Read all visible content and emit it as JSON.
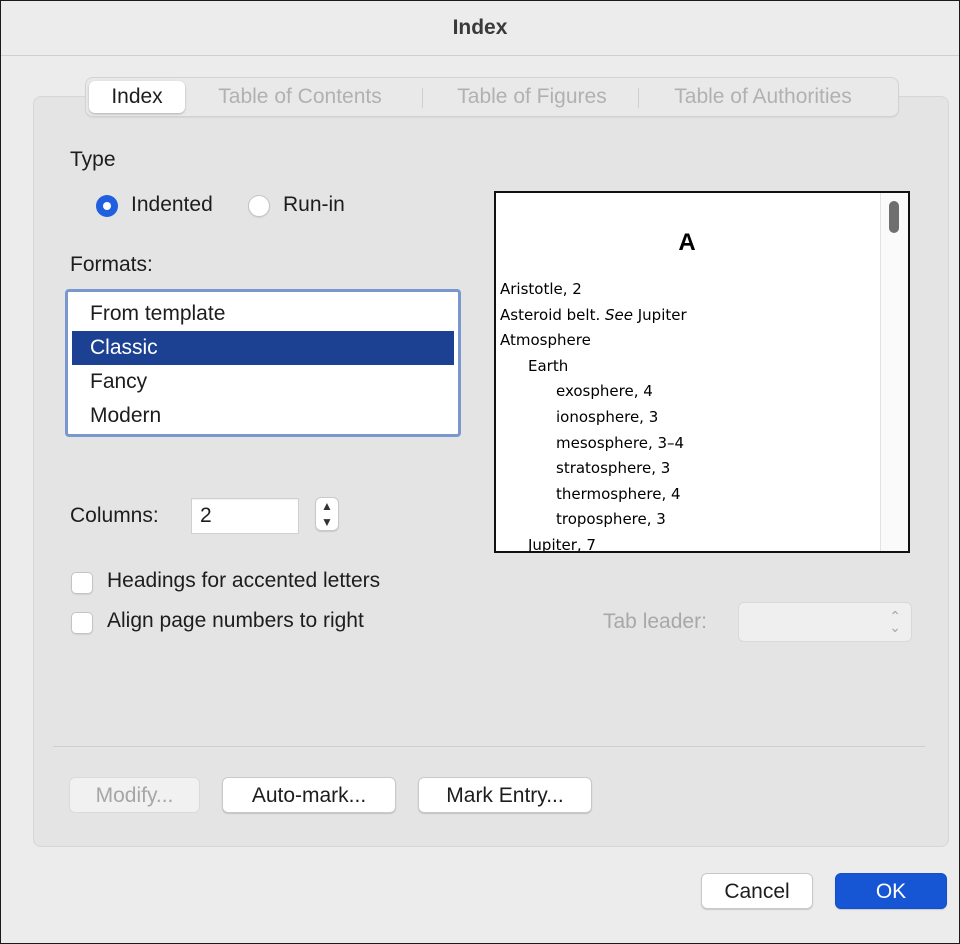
{
  "dialog": {
    "title": "Index"
  },
  "tabs": [
    {
      "label": "Index",
      "active": true
    },
    {
      "label": "Table of Contents",
      "active": false
    },
    {
      "label": "Table of Figures",
      "active": false
    },
    {
      "label": "Table of Authorities",
      "active": false
    }
  ],
  "type": {
    "label": "Type",
    "options": [
      {
        "label": "Indented",
        "selected": true
      },
      {
        "label": "Run-in",
        "selected": false
      }
    ]
  },
  "formats": {
    "label": "Formats:",
    "items": [
      "From template",
      "Classic",
      "Fancy",
      "Modern"
    ],
    "selected": "Classic"
  },
  "preview": {
    "letter": "A",
    "lines": [
      {
        "text": "Aristotle, 2",
        "level": 0
      },
      {
        "text": "Asteroid belt. ",
        "italic": "See",
        "after": " Jupiter",
        "level": 0
      },
      {
        "text": "Atmosphere",
        "level": 0
      },
      {
        "text": "Earth",
        "level": 1
      },
      {
        "text": "exosphere, 4",
        "level": 2
      },
      {
        "text": "ionosphere, 3",
        "level": 2
      },
      {
        "text": "mesosphere, 3–4",
        "level": 2
      },
      {
        "text": "stratosphere, 3",
        "level": 2
      },
      {
        "text": "thermosphere, 4",
        "level": 2
      },
      {
        "text": "troposphere, 3",
        "level": 2
      },
      {
        "text": "Jupiter, 7",
        "level": 1
      }
    ]
  },
  "columns": {
    "label": "Columns:",
    "value": "2"
  },
  "checkboxes": {
    "headings_label": "Headings for accented letters",
    "headings_checked": false,
    "align_label": "Align page numbers to right",
    "align_checked": false
  },
  "tab_leader": {
    "label": "Tab leader:",
    "value": ""
  },
  "buttons": {
    "modify": "Modify...",
    "auto_mark": "Auto-mark...",
    "mark_entry": "Mark Entry...",
    "cancel": "Cancel",
    "ok": "OK"
  },
  "colors": {
    "accent": "#1656d4",
    "selection": "#1c4193",
    "focus_ring": "#7b97d0"
  }
}
